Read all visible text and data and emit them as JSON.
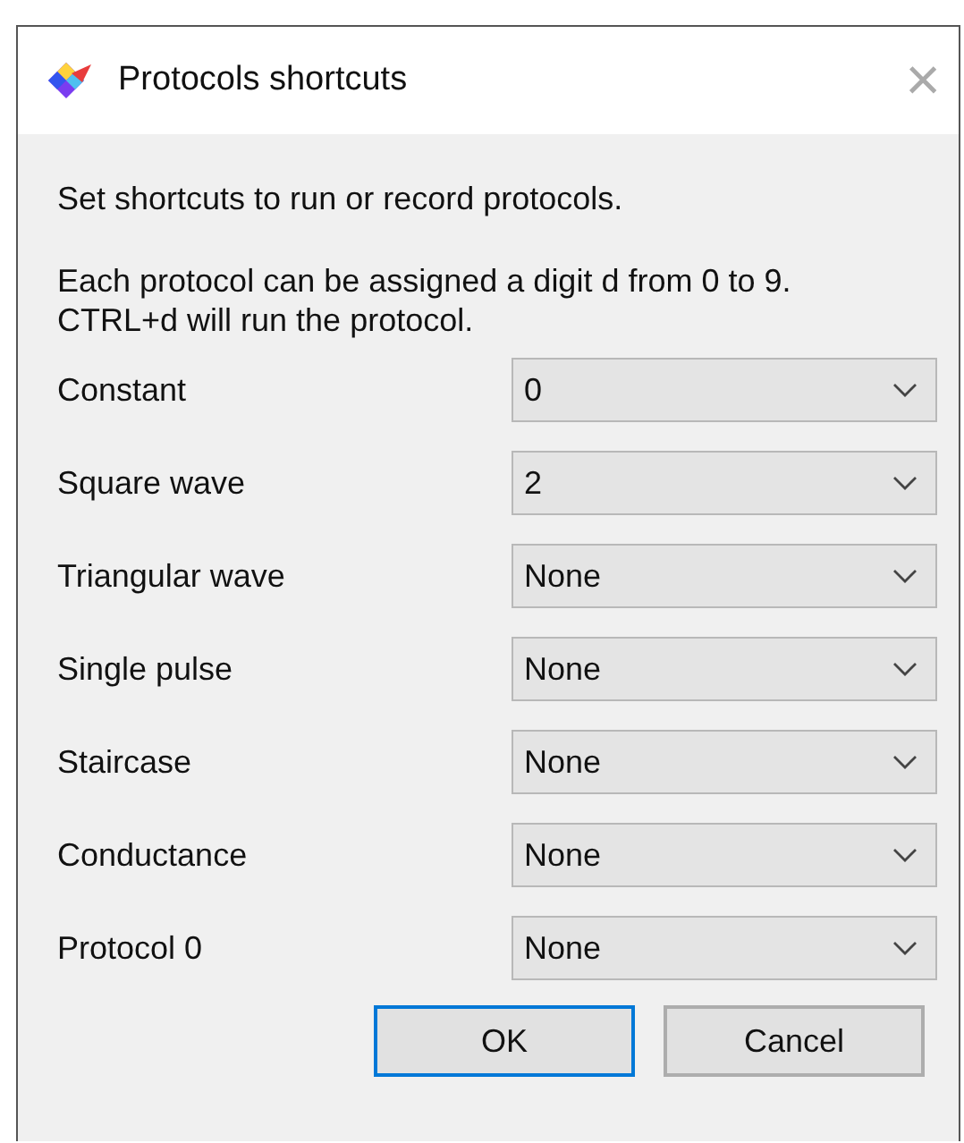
{
  "window": {
    "title": "Protocols shortcuts",
    "close": "×"
  },
  "intro": "Set shortcuts to run or record protocols.",
  "help": [
    "Each protocol can be assigned a digit d from 0 to 9.",
    "CTRL+d will run the protocol."
  ],
  "rows": [
    {
      "label": "Constant",
      "value": "0"
    },
    {
      "label": "Square wave",
      "value": "2"
    },
    {
      "label": "Triangular wave",
      "value": "None"
    },
    {
      "label": "Single pulse",
      "value": "None"
    },
    {
      "label": "Staircase",
      "value": "None"
    },
    {
      "label": "Conductance",
      "value": "None"
    },
    {
      "label": "Protocol 0",
      "value": "None"
    }
  ],
  "buttons": [
    {
      "label": "OK",
      "default": true
    },
    {
      "label": "Cancel",
      "default": false
    }
  ]
}
